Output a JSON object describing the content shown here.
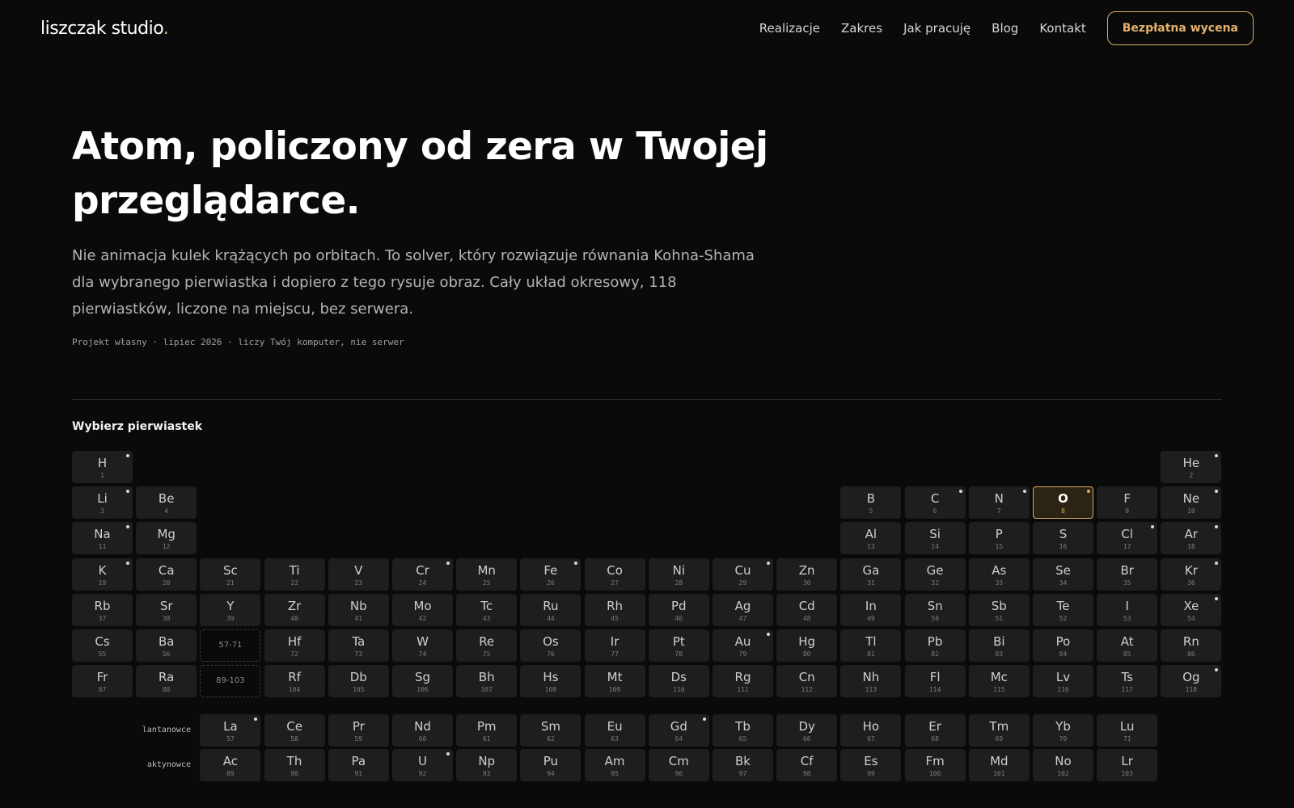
{
  "header": {
    "logo": "liszczak studio",
    "logo_dot": ".",
    "nav": [
      "Realizacje",
      "Zakres",
      "Jak pracuję",
      "Blog",
      "Kontakt"
    ],
    "cta": "Bezpłatna wycena"
  },
  "hero": {
    "title_line1": "Atom, policzony od zera w Twojej",
    "title_line2": "przeglądarce.",
    "lead": "Nie animacja kulek krążących po orbitach. To solver, który rozwiązuje równania Kohna-Shama dla wybranego pierwiastka i dopiero z tego rysuje obraz. Cały układ okresowy, 118 pierwiastków, liczone na miejscu, bez serwera.",
    "meta": "Projekt własny · lipiec 2026 · liczy Twój komputer, nie serwer"
  },
  "table": {
    "title": "Wybierz pierwiastek",
    "selected": "O",
    "lanthanides_label": "lantanowce",
    "actinides_label": "aktynowce",
    "placeholders": [
      {
        "label": "57-71",
        "period": 6,
        "group": 3
      },
      {
        "label": "89-103",
        "period": 7,
        "group": 3
      }
    ],
    "main": [
      {
        "s": "H",
        "n": 1,
        "p": 1,
        "g": 1,
        "m": true
      },
      {
        "s": "He",
        "n": 2,
        "p": 1,
        "g": 18,
        "m": true
      },
      {
        "s": "Li",
        "n": 3,
        "p": 2,
        "g": 1,
        "m": true
      },
      {
        "s": "Be",
        "n": 4,
        "p": 2,
        "g": 2
      },
      {
        "s": "B",
        "n": 5,
        "p": 2,
        "g": 13
      },
      {
        "s": "C",
        "n": 6,
        "p": 2,
        "g": 14,
        "m": true
      },
      {
        "s": "N",
        "n": 7,
        "p": 2,
        "g": 15,
        "m": true
      },
      {
        "s": "O",
        "n": 8,
        "p": 2,
        "g": 16,
        "m": true
      },
      {
        "s": "F",
        "n": 9,
        "p": 2,
        "g": 17
      },
      {
        "s": "Ne",
        "n": 10,
        "p": 2,
        "g": 18,
        "m": true
      },
      {
        "s": "Na",
        "n": 11,
        "p": 3,
        "g": 1,
        "m": true
      },
      {
        "s": "Mg",
        "n": 12,
        "p": 3,
        "g": 2
      },
      {
        "s": "Al",
        "n": 13,
        "p": 3,
        "g": 13
      },
      {
        "s": "Si",
        "n": 14,
        "p": 3,
        "g": 14
      },
      {
        "s": "P",
        "n": 15,
        "p": 3,
        "g": 15
      },
      {
        "s": "S",
        "n": 16,
        "p": 3,
        "g": 16
      },
      {
        "s": "Cl",
        "n": 17,
        "p": 3,
        "g": 17,
        "m": true
      },
      {
        "s": "Ar",
        "n": 18,
        "p": 3,
        "g": 18,
        "m": true
      },
      {
        "s": "K",
        "n": 19,
        "p": 4,
        "g": 1,
        "m": true
      },
      {
        "s": "Ca",
        "n": 20,
        "p": 4,
        "g": 2
      },
      {
        "s": "Sc",
        "n": 21,
        "p": 4,
        "g": 3
      },
      {
        "s": "Ti",
        "n": 22,
        "p": 4,
        "g": 4
      },
      {
        "s": "V",
        "n": 23,
        "p": 4,
        "g": 5
      },
      {
        "s": "Cr",
        "n": 24,
        "p": 4,
        "g": 6,
        "m": true
      },
      {
        "s": "Mn",
        "n": 25,
        "p": 4,
        "g": 7
      },
      {
        "s": "Fe",
        "n": 26,
        "p": 4,
        "g": 8,
        "m": true
      },
      {
        "s": "Co",
        "n": 27,
        "p": 4,
        "g": 9
      },
      {
        "s": "Ni",
        "n": 28,
        "p": 4,
        "g": 10
      },
      {
        "s": "Cu",
        "n": 29,
        "p": 4,
        "g": 11,
        "m": true
      },
      {
        "s": "Zn",
        "n": 30,
        "p": 4,
        "g": 12
      },
      {
        "s": "Ga",
        "n": 31,
        "p": 4,
        "g": 13
      },
      {
        "s": "Ge",
        "n": 32,
        "p": 4,
        "g": 14
      },
      {
        "s": "As",
        "n": 33,
        "p": 4,
        "g": 15
      },
      {
        "s": "Se",
        "n": 34,
        "p": 4,
        "g": 16
      },
      {
        "s": "Br",
        "n": 35,
        "p": 4,
        "g": 17
      },
      {
        "s": "Kr",
        "n": 36,
        "p": 4,
        "g": 18,
        "m": true
      },
      {
        "s": "Rb",
        "n": 37,
        "p": 5,
        "g": 1
      },
      {
        "s": "Sr",
        "n": 38,
        "p": 5,
        "g": 2
      },
      {
        "s": "Y",
        "n": 39,
        "p": 5,
        "g": 3
      },
      {
        "s": "Zr",
        "n": 40,
        "p": 5,
        "g": 4
      },
      {
        "s": "Nb",
        "n": 41,
        "p": 5,
        "g": 5
      },
      {
        "s": "Mo",
        "n": 42,
        "p": 5,
        "g": 6
      },
      {
        "s": "Tc",
        "n": 43,
        "p": 5,
        "g": 7
      },
      {
        "s": "Ru",
        "n": 44,
        "p": 5,
        "g": 8
      },
      {
        "s": "Rh",
        "n": 45,
        "p": 5,
        "g": 9
      },
      {
        "s": "Pd",
        "n": 46,
        "p": 5,
        "g": 10
      },
      {
        "s": "Ag",
        "n": 47,
        "p": 5,
        "g": 11
      },
      {
        "s": "Cd",
        "n": 48,
        "p": 5,
        "g": 12
      },
      {
        "s": "In",
        "n": 49,
        "p": 5,
        "g": 13
      },
      {
        "s": "Sn",
        "n": 50,
        "p": 5,
        "g": 14
      },
      {
        "s": "Sb",
        "n": 51,
        "p": 5,
        "g": 15
      },
      {
        "s": "Te",
        "n": 52,
        "p": 5,
        "g": 16
      },
      {
        "s": "I",
        "n": 53,
        "p": 5,
        "g": 17
      },
      {
        "s": "Xe",
        "n": 54,
        "p": 5,
        "g": 18,
        "m": true
      },
      {
        "s": "Cs",
        "n": 55,
        "p": 6,
        "g": 1
      },
      {
        "s": "Ba",
        "n": 56,
        "p": 6,
        "g": 2
      },
      {
        "s": "Hf",
        "n": 72,
        "p": 6,
        "g": 4
      },
      {
        "s": "Ta",
        "n": 73,
        "p": 6,
        "g": 5
      },
      {
        "s": "W",
        "n": 74,
        "p": 6,
        "g": 6
      },
      {
        "s": "Re",
        "n": 75,
        "p": 6,
        "g": 7
      },
      {
        "s": "Os",
        "n": 76,
        "p": 6,
        "g": 8
      },
      {
        "s": "Ir",
        "n": 77,
        "p": 6,
        "g": 9
      },
      {
        "s": "Pt",
        "n": 78,
        "p": 6,
        "g": 10
      },
      {
        "s": "Au",
        "n": 79,
        "p": 6,
        "g": 11,
        "m": true
      },
      {
        "s": "Hg",
        "n": 80,
        "p": 6,
        "g": 12
      },
      {
        "s": "Tl",
        "n": 81,
        "p": 6,
        "g": 13
      },
      {
        "s": "Pb",
        "n": 82,
        "p": 6,
        "g": 14
      },
      {
        "s": "Bi",
        "n": 83,
        "p": 6,
        "g": 15
      },
      {
        "s": "Po",
        "n": 84,
        "p": 6,
        "g": 16
      },
      {
        "s": "At",
        "n": 85,
        "p": 6,
        "g": 17
      },
      {
        "s": "Rn",
        "n": 86,
        "p": 6,
        "g": 18
      },
      {
        "s": "Fr",
        "n": 87,
        "p": 7,
        "g": 1
      },
      {
        "s": "Ra",
        "n": 88,
        "p": 7,
        "g": 2
      },
      {
        "s": "Rf",
        "n": 104,
        "p": 7,
        "g": 4
      },
      {
        "s": "Db",
        "n": 105,
        "p": 7,
        "g": 5
      },
      {
        "s": "Sg",
        "n": 106,
        "p": 7,
        "g": 6
      },
      {
        "s": "Bh",
        "n": 107,
        "p": 7,
        "g": 7
      },
      {
        "s": "Hs",
        "n": 108,
        "p": 7,
        "g": 8
      },
      {
        "s": "Mt",
        "n": 109,
        "p": 7,
        "g": 9
      },
      {
        "s": "Ds",
        "n": 110,
        "p": 7,
        "g": 10
      },
      {
        "s": "Rg",
        "n": 111,
        "p": 7,
        "g": 11
      },
      {
        "s": "Cn",
        "n": 112,
        "p": 7,
        "g": 12
      },
      {
        "s": "Nh",
        "n": 113,
        "p": 7,
        "g": 13
      },
      {
        "s": "Fl",
        "n": 114,
        "p": 7,
        "g": 14
      },
      {
        "s": "Mc",
        "n": 115,
        "p": 7,
        "g": 15
      },
      {
        "s": "Lv",
        "n": 116,
        "p": 7,
        "g": 16
      },
      {
        "s": "Ts",
        "n": 117,
        "p": 7,
        "g": 17
      },
      {
        "s": "Og",
        "n": 118,
        "p": 7,
        "g": 18,
        "m": true
      }
    ],
    "lanthanides": [
      {
        "s": "La",
        "n": 57,
        "m": true
      },
      {
        "s": "Ce",
        "n": 58
      },
      {
        "s": "Pr",
        "n": 59
      },
      {
        "s": "Nd",
        "n": 60
      },
      {
        "s": "Pm",
        "n": 61
      },
      {
        "s": "Sm",
        "n": 62
      },
      {
        "s": "Eu",
        "n": 63
      },
      {
        "s": "Gd",
        "n": 64,
        "m": true
      },
      {
        "s": "Tb",
        "n": 65
      },
      {
        "s": "Dy",
        "n": 66
      },
      {
        "s": "Ho",
        "n": 67
      },
      {
        "s": "Er",
        "n": 68
      },
      {
        "s": "Tm",
        "n": 69
      },
      {
        "s": "Yb",
        "n": 70
      },
      {
        "s": "Lu",
        "n": 71
      }
    ],
    "actinides": [
      {
        "s": "Ac",
        "n": 89
      },
      {
        "s": "Th",
        "n": 90
      },
      {
        "s": "Pa",
        "n": 91
      },
      {
        "s": "U",
        "n": 92,
        "m": true
      },
      {
        "s": "Np",
        "n": 93
      },
      {
        "s": "Pu",
        "n": 94
      },
      {
        "s": "Am",
        "n": 95
      },
      {
        "s": "Cm",
        "n": 96
      },
      {
        "s": "Bk",
        "n": 97
      },
      {
        "s": "Cf",
        "n": 98
      },
      {
        "s": "Es",
        "n": 99
      },
      {
        "s": "Fm",
        "n": 100
      },
      {
        "s": "Md",
        "n": 101
      },
      {
        "s": "No",
        "n": 102
      },
      {
        "s": "Lr",
        "n": 103
      }
    ]
  },
  "colors": {
    "background": "#0a0a0a",
    "accent": "#d9ad66",
    "cell": "#1e1e1e"
  }
}
